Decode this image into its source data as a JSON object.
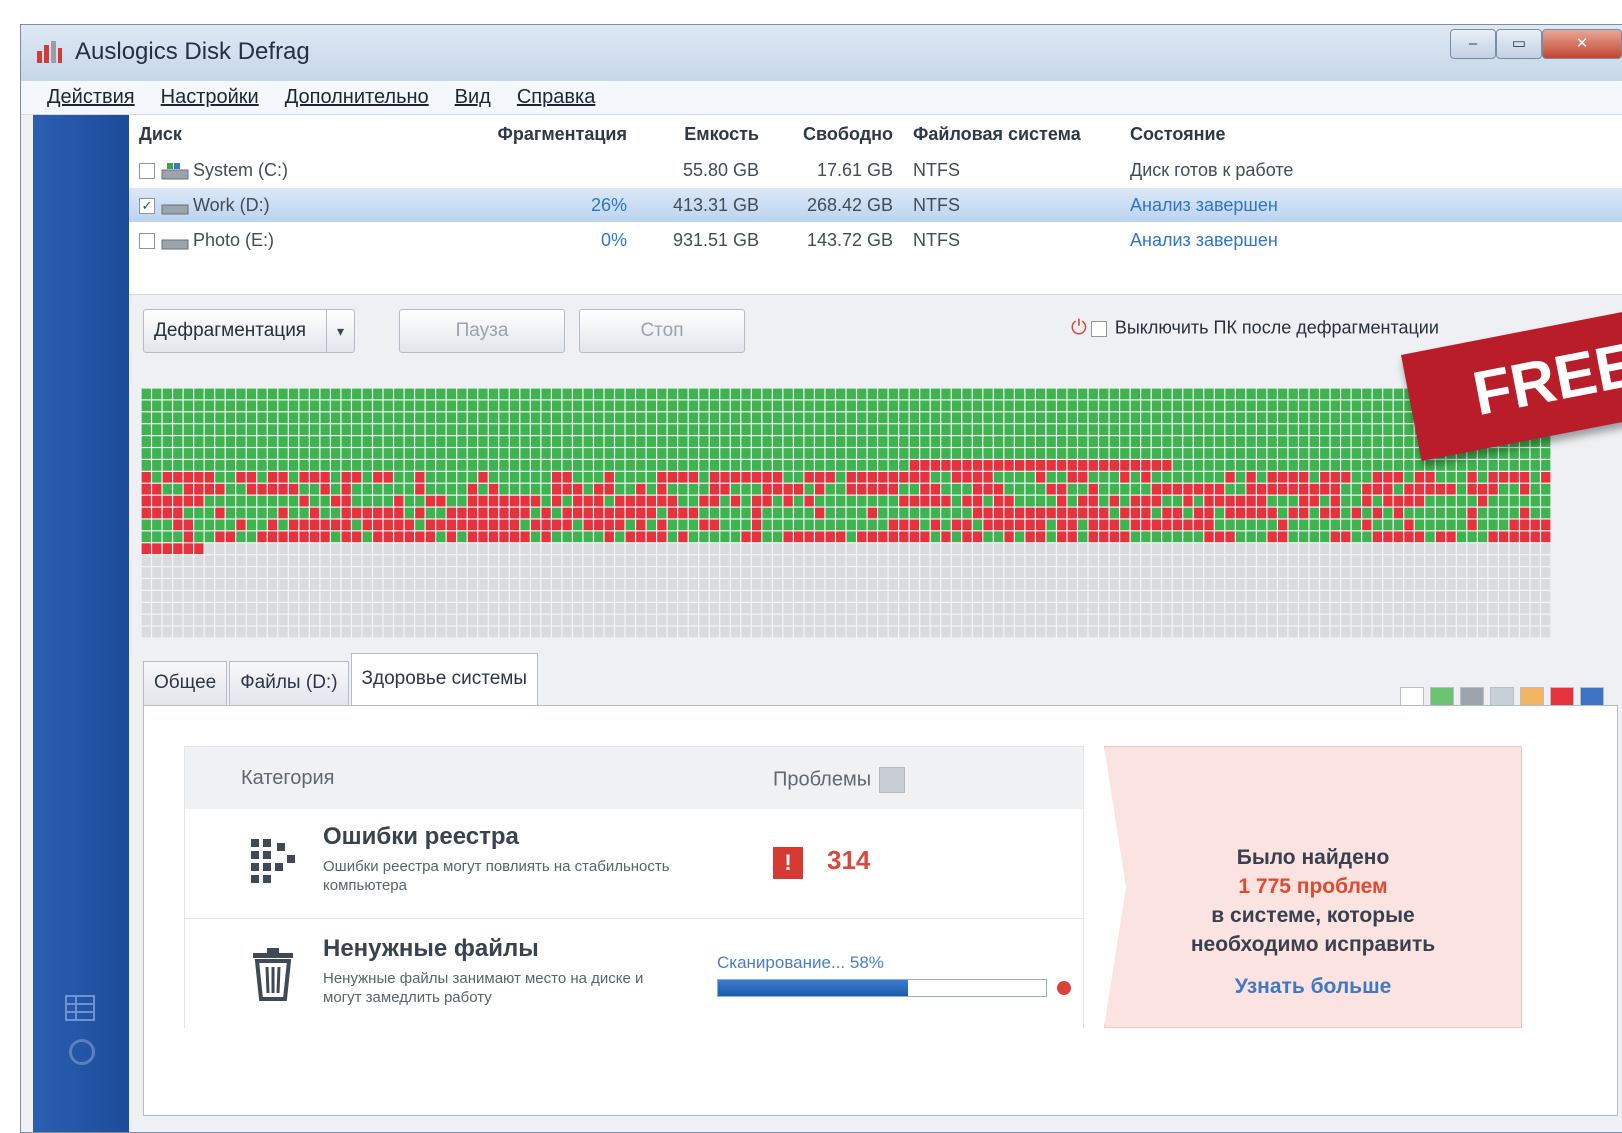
{
  "window": {
    "title": "Auslogics Disk Defrag",
    "controls": {
      "minimize": "–",
      "maximize": "▭",
      "close": "✕"
    }
  },
  "menu": [
    "Действия",
    "Настройки",
    "Дополнительно",
    "Вид",
    "Справка"
  ],
  "disk_table": {
    "headers": {
      "disk": "Диск",
      "fragmentation": "Фрагментация",
      "capacity": "Емкость",
      "free": "Свободно",
      "filesystem": "Файловая система",
      "state": "Состояние"
    },
    "rows": [
      {
        "name": "System (C:)",
        "checked": false,
        "fragmentation": "",
        "capacity": "55.80 GB",
        "free": "17.61 GB",
        "filesystem": "NTFS",
        "state": "Диск готов к работе",
        "selected": false
      },
      {
        "name": "Work (D:)",
        "checked": true,
        "fragmentation": "26%",
        "capacity": "413.31 GB",
        "free": "268.42 GB",
        "filesystem": "NTFS",
        "state": "Анализ завершен",
        "selected": true
      },
      {
        "name": "Photo (E:)",
        "checked": false,
        "fragmentation": "0%",
        "capacity": "931.51 GB",
        "free": "143.72 GB",
        "filesystem": "NTFS",
        "state": "Анализ завершен",
        "selected": false
      }
    ]
  },
  "controls": {
    "defrag_label": "Дефрагментация",
    "dropdown_arrow": "▾",
    "pause_label": "Пауза",
    "stop_label": "Стоп",
    "shutdown_label": "Выключить ПК после дефрагментации",
    "shutdown_checked": false
  },
  "banner": {
    "text": "FREE"
  },
  "cluster_map": {
    "colors": {
      "free": "#d9dcdf",
      "used": "#3fb34f",
      "fragmented": "#e5323d",
      "grid": "#f3f4f6"
    }
  },
  "tabs": [
    {
      "label": "Общее",
      "active": false
    },
    {
      "label": "Файлы (D:)",
      "active": false
    },
    {
      "label": "Здоровье системы",
      "active": true
    }
  ],
  "legend_colors": [
    "#ffffff",
    "#6cc36f",
    "#9ea4ab",
    "#c8cfd6",
    "#f3b561",
    "#e5323d",
    "#3d72c4"
  ],
  "health": {
    "col_category": "Категория",
    "col_problems": "Проблемы",
    "registry": {
      "title": "Ошибки реестра",
      "description": "Ошибки реестра могут повлиять на стабильность компьютера",
      "badge": "!",
      "count": "314"
    },
    "junk": {
      "title": "Ненужные файлы",
      "description": "Ненужные файлы занимают место на диске и могут замедлить работу",
      "scan_label": "Сканирование... 58%",
      "progress": 0.58
    }
  },
  "found": {
    "line1": "Было найдено",
    "count": "1 775 проблем",
    "line2": "в системе, которые",
    "line3": "необходимо исправить",
    "link": "Узнать больше"
  }
}
